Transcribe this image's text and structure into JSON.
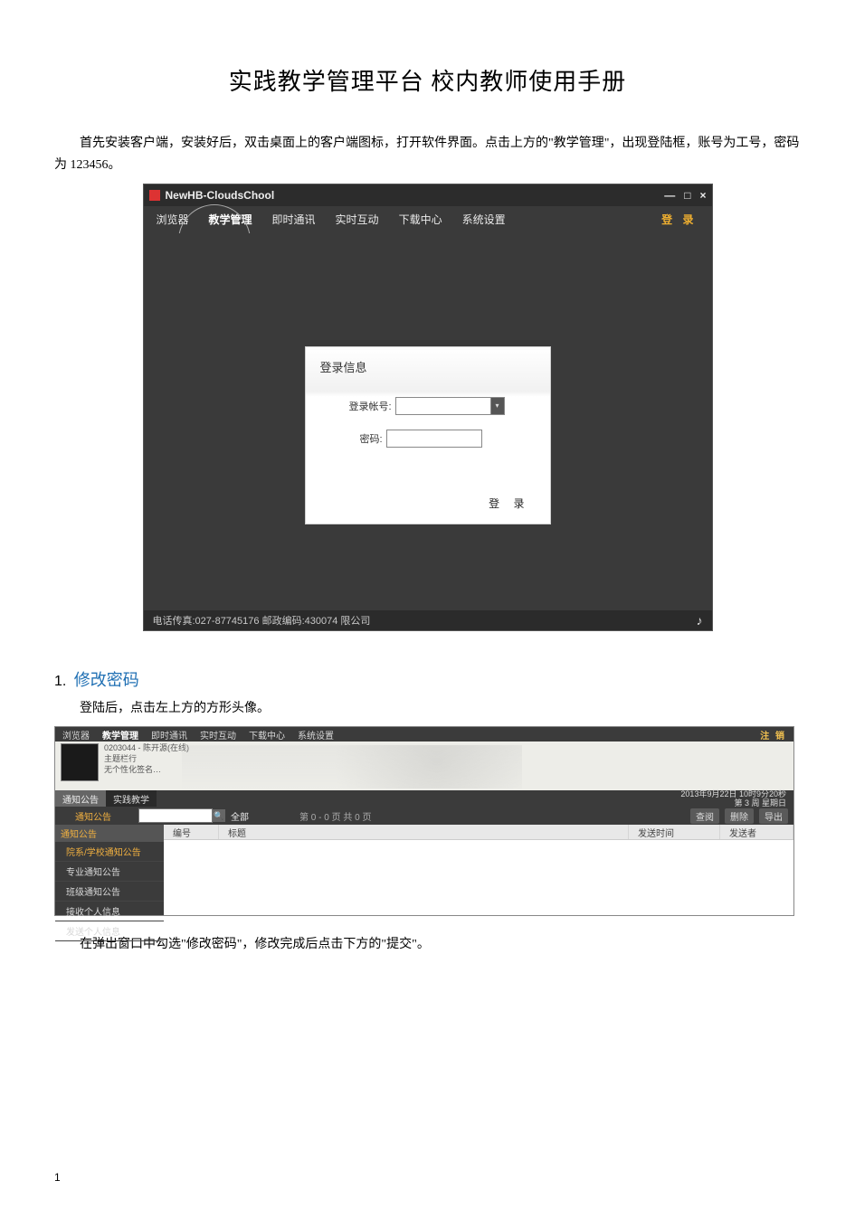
{
  "doc": {
    "title": "实践教学管理平台 校内教师使用手册",
    "intro": "首先安装客户端，安装好后，双击桌面上的客户端图标，打开软件界面。点击上方的\"教学管理\"，出现登陆框，账号为工号，密码为 123456。",
    "section1_num": "1.",
    "section1_title": "修改密码",
    "section1_p1": "登陆后，点击左上方的方形头像。",
    "section1_p2": "在弹出窗口中勾选\"修改密码\"，修改完成后点击下方的\"提交\"。",
    "page_number": "1"
  },
  "shot1": {
    "window_title": "NewHB-CloudsChool",
    "window_controls": {
      "min": "—",
      "max": "□",
      "close": "×"
    },
    "menus": [
      "浏览器",
      "教学管理",
      "即时通讯",
      "实时互动",
      "下载中心",
      "系统设置"
    ],
    "active_menu_index": 1,
    "top_login": "登 录",
    "panel_title": "登录信息",
    "field_account_label": "登录帐号:",
    "field_password_label": "密码:",
    "login_button": "登  录",
    "statusbar": "电话传真:027-87745176 邮政编码:430074 限公司"
  },
  "shot2": {
    "menus": [
      "浏览器",
      "教学管理",
      "即时通讯",
      "实时互动",
      "下载中心",
      "系统设置"
    ],
    "active_menu_index": 1,
    "logout": "注 销",
    "user_line1": "0203044 - 陈开源(在线)",
    "user_line2": "主题栏行",
    "user_line3": "无个性化签名…",
    "tab_main": "通知公告",
    "tab_sub": "实践教学",
    "datetime_line1": "2013年9月22日 10时9分20秒",
    "datetime_line2": "第 3 周    星期日",
    "toolbar_label": "通知公告",
    "filter_all": "全部",
    "paging": "第 0 - 0 页 共 0 页",
    "btn_view": "查阅",
    "btn_delete": "删除",
    "btn_export": "导出",
    "sidebar_header": "通知公告",
    "sidebar_items": [
      "院系/学校通知公告",
      "专业通知公告",
      "班级通知公告",
      "接收个人信息",
      "发送个人信息"
    ],
    "table_headers": [
      "编号",
      "标题",
      "发送时间",
      "发送者"
    ]
  }
}
